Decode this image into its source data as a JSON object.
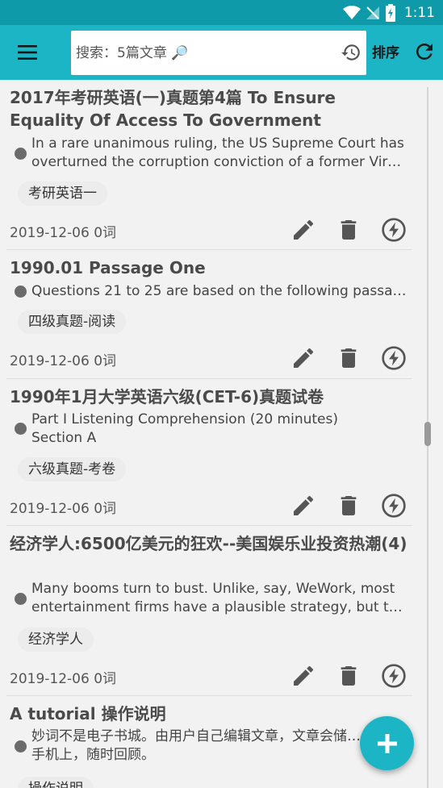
{
  "status_bar": {
    "time": "1:11"
  },
  "toolbar": {
    "search_placeholder": "搜索：5篇文章 🔎",
    "sort_label": "排序"
  },
  "articles": [
    {
      "title": "2017年考研英语(一)真题第4篇 To Ensure Equality Of Access To Government",
      "summary_line1": "In a rare unanimous ruling, the US Supreme Court has",
      "summary_line2": "overturned the corruption conviction of a former Virgini…",
      "tag": "考研英语一",
      "meta": "2019-12-06 0词"
    },
    {
      "title": "1990.01 Passage One",
      "summary_line1": "Questions 21 to 25 are based on the following passage.",
      "summary_line2": "",
      "tag": "四级真题-阅读",
      "meta": "2019-12-06 0词"
    },
    {
      "title": "1990年1月大学英语六级(CET-6)真题试卷",
      "summary_line1": "Part I Listening Comprehension (20 minutes)",
      "summary_line2": "Section A",
      "tag": "六级真题-考卷",
      "meta": "2019-12-06 0词"
    },
    {
      "title": "经济学人:6500亿美元的狂欢--美国娱乐业投资热潮(4)",
      "summary_line1": "Many booms turn to bust. Unlike, say, WeWork, most",
      "summary_line2": "entertainment firms have a plausible strategy, but too…",
      "tag": "经济学人",
      "meta": "2019-12-06 0词"
    },
    {
      "title": "A tutorial 操作说明",
      "summary_line1": "妙词不是电子书城。由用户自己编辑文章，文章会储存在",
      "summary_line2": "手机上，随时回顾。",
      "tag": "操作说明",
      "meta": ""
    }
  ],
  "colors": {
    "accent": "#1cb5c6",
    "status_bar": "#0f9aa9",
    "icon_gray": "#555555"
  }
}
